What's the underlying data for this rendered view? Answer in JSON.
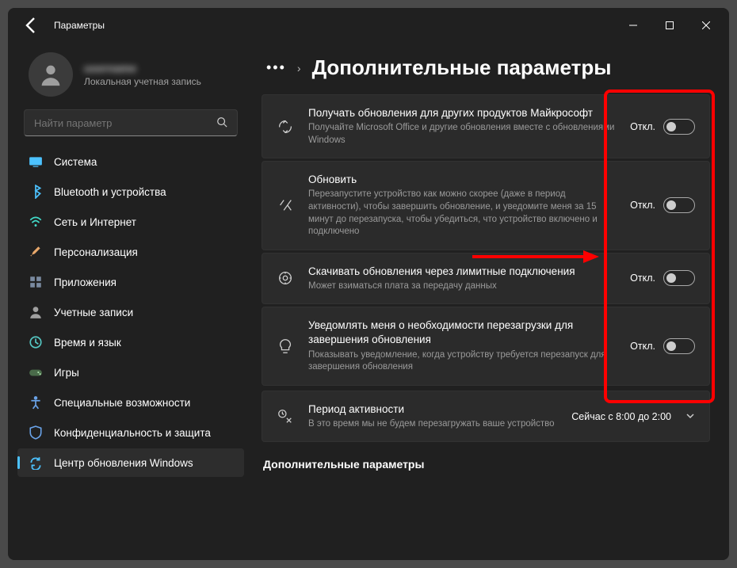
{
  "window": {
    "title": "Параметры"
  },
  "profile": {
    "name": "username",
    "type": "Локальная учетная запись"
  },
  "search": {
    "placeholder": "Найти параметр"
  },
  "sidebar": {
    "items": [
      {
        "icon": "system",
        "label": "Система",
        "color": "#4cc2ff"
      },
      {
        "icon": "bluetooth",
        "label": "Bluetooth и устройства",
        "color": "#4cc2ff"
      },
      {
        "icon": "wifi",
        "label": "Сеть и Интернет",
        "color": "#41d9c8"
      },
      {
        "icon": "brush",
        "label": "Персонализация",
        "color": "#e8a86b"
      },
      {
        "icon": "apps",
        "label": "Приложения",
        "color": "#7a8aa0"
      },
      {
        "icon": "account",
        "label": "Учетные записи",
        "color": "#a0a0a0"
      },
      {
        "icon": "time",
        "label": "Время и язык",
        "color": "#55c6c2"
      },
      {
        "icon": "games",
        "label": "Игры",
        "color": "#6fb36f"
      },
      {
        "icon": "a11y",
        "label": "Специальные возможности",
        "color": "#6aa3e8"
      },
      {
        "icon": "privacy",
        "label": "Конфиденциальность и защита",
        "color": "#6aa3e8"
      },
      {
        "icon": "update",
        "label": "Центр обновления Windows",
        "color": "#4cc2ff",
        "active": true
      }
    ]
  },
  "heading": "Дополнительные параметры",
  "toggle_off": "Откл.",
  "cards": [
    {
      "title": "Получать обновления для других продуктов Майкрософт",
      "desc": "Получайте Microsoft Office и другие обновления вместе с обновлениями Windows"
    },
    {
      "title": "Обновить",
      "desc": "Перезапустите устройство как можно скорее (даже в период активности), чтобы завершить обновление, и уведомите меня за 15 минут до перезапуска, чтобы убедиться, что устройство включено и подключено"
    },
    {
      "title": "Скачивать обновления через лимитные подключения",
      "desc": "Может взиматься плата за передачу данных"
    },
    {
      "title": "Уведомлять меня о необходимости перезагрузки для завершения обновления",
      "desc": "Показывать уведомление, когда устройству требуется перезапуск для завершения обновления"
    }
  ],
  "activity": {
    "title": "Период активности",
    "desc": "В это время мы не будем перезагружать ваше устройство",
    "value": "Сейчас с 8:00 до 2:00"
  },
  "section2": "Дополнительные параметры"
}
